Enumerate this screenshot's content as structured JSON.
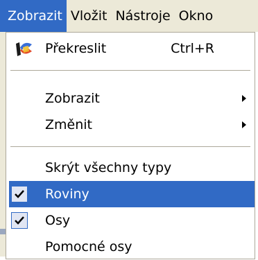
{
  "menubar": {
    "items": [
      {
        "label": "Zobrazit",
        "active": true
      },
      {
        "label": "Vložit"
      },
      {
        "label": "Nástroje"
      },
      {
        "label": "Okno"
      }
    ]
  },
  "menu": {
    "redraw": {
      "label": "Překreslit",
      "shortcut": "Ctrl+R",
      "icon": "redraw-icon"
    },
    "view": {
      "label": "Zobrazit",
      "has_submenu": true
    },
    "change": {
      "label": "Změnit",
      "has_submenu": true
    },
    "hide_all_types": {
      "label": "Skrýt všechny typy"
    },
    "planes": {
      "label": "Roviny",
      "checked": true,
      "highlighted": true
    },
    "axes": {
      "label": "Osy",
      "checked": true
    },
    "helper_axes": {
      "label": "Pomocné osy"
    }
  },
  "colors": {
    "highlight": "#316ac5",
    "menu_bg": "#ece9d8",
    "separator": "#aca899"
  }
}
